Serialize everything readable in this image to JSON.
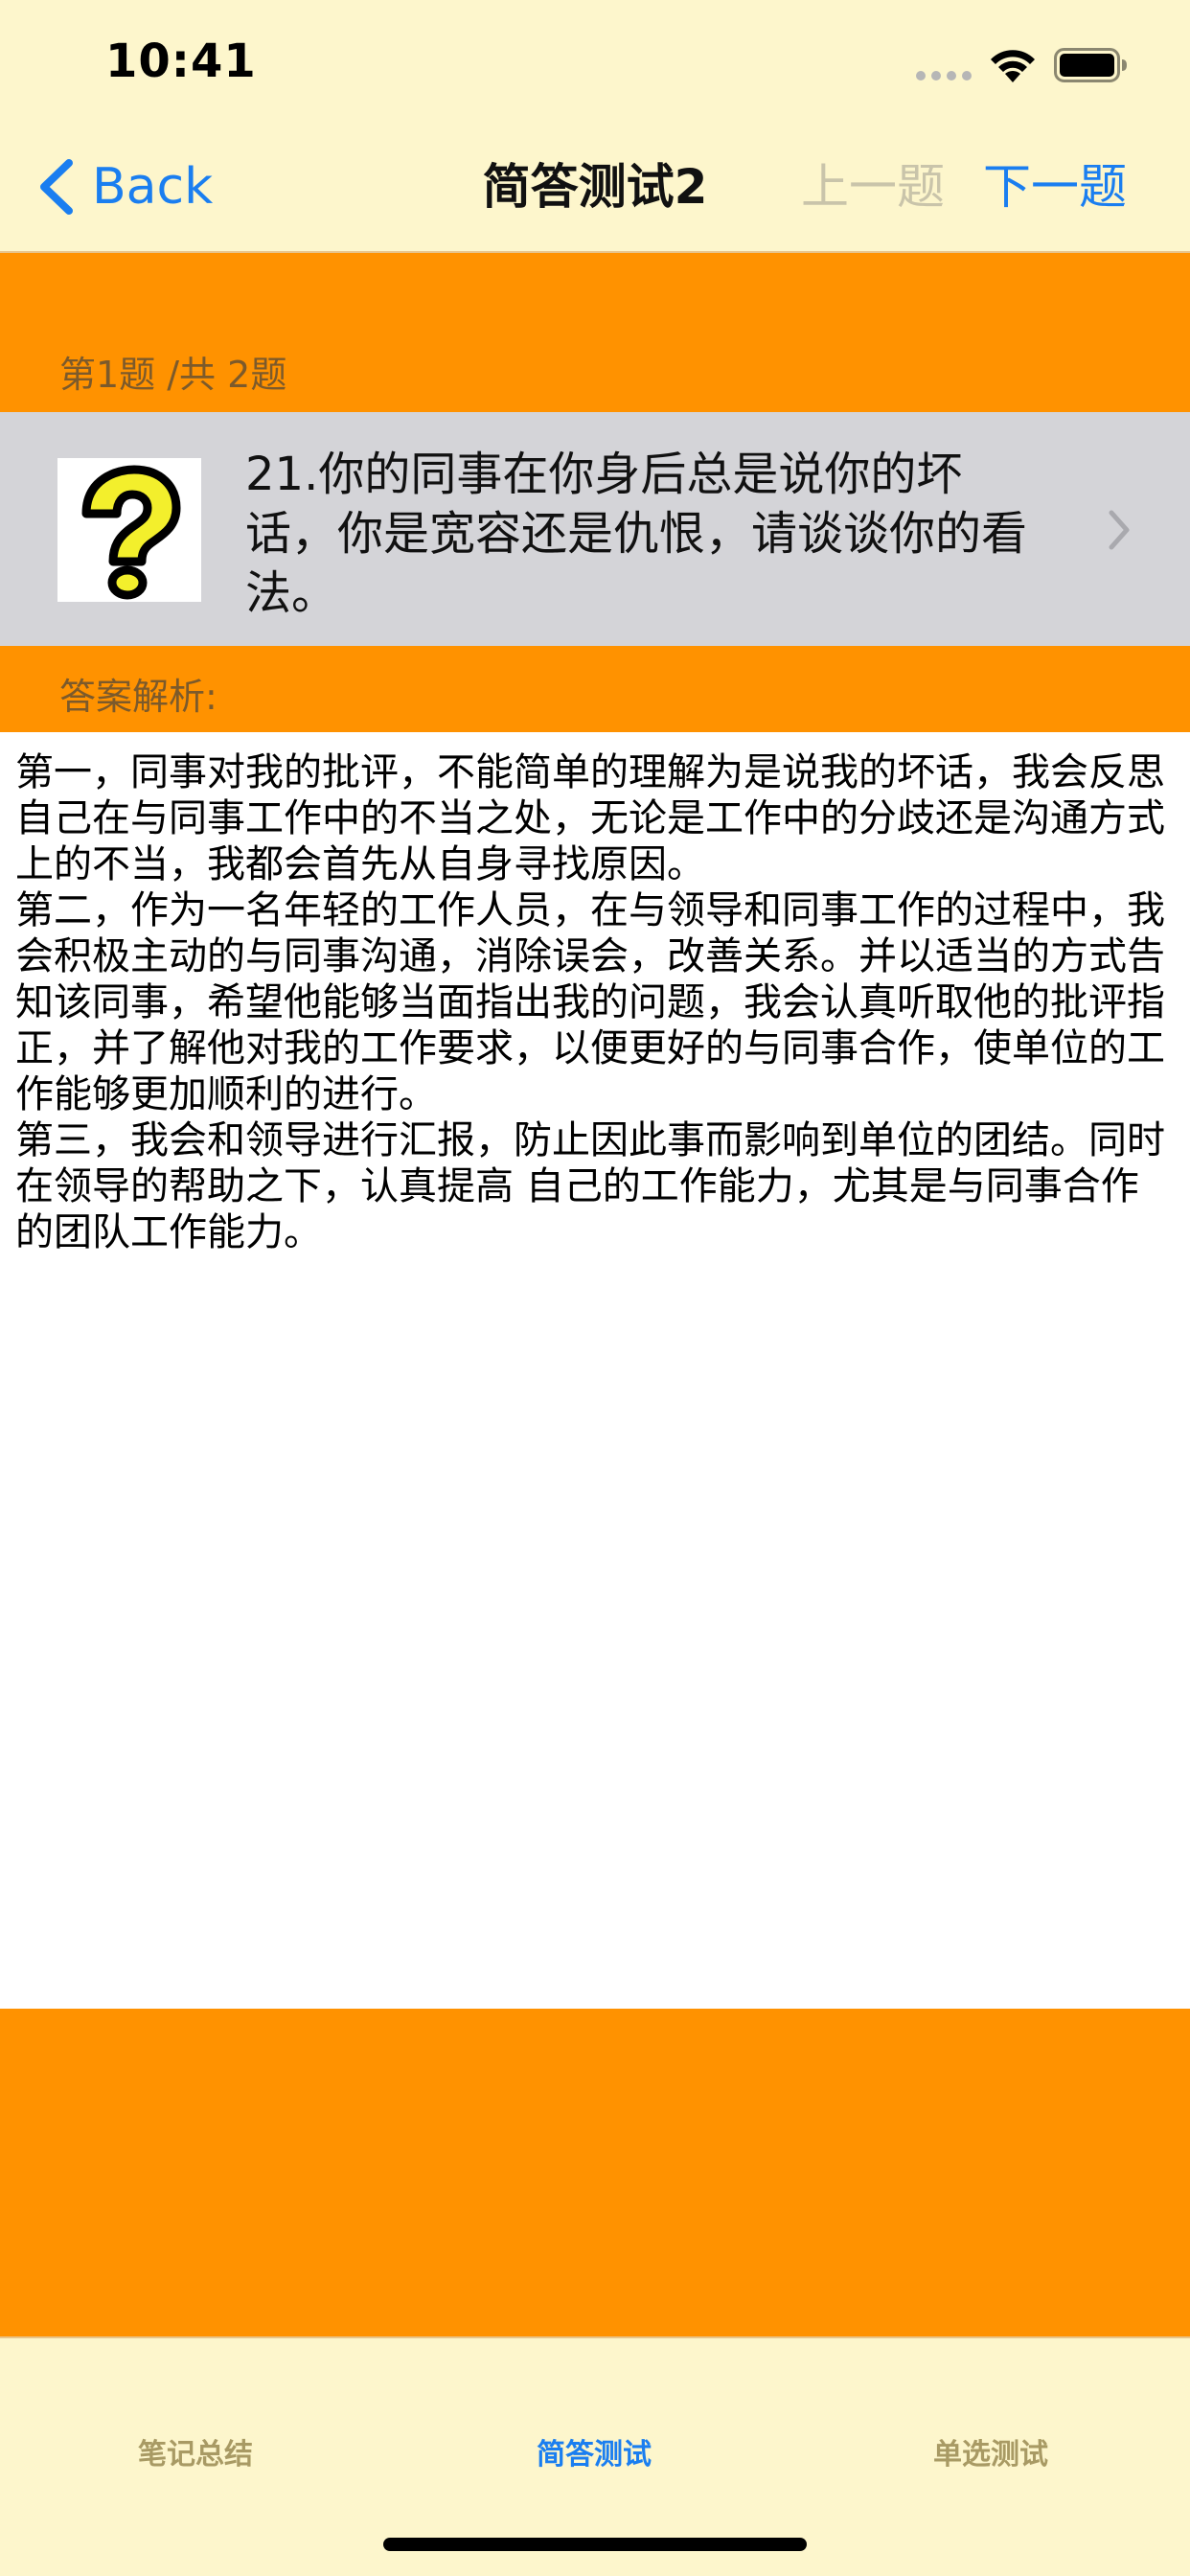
{
  "status_bar": {
    "time": "10:41",
    "icons": [
      "signal-dots-icon",
      "wifi-icon",
      "battery-icon"
    ]
  },
  "nav": {
    "back_label": "Back",
    "title": "简答测试2",
    "prev_label": "上一题",
    "next_label": "下一题"
  },
  "question": {
    "counter": "第1题 /共 2题",
    "text": "21.你的同事在你身后总是说你的坏话，你是宽容还是仇恨，请谈谈你的看法。",
    "icon": "question-mark-icon"
  },
  "answer": {
    "header": "答案解析:",
    "text": "第一，同事对我的批评，不能简单的理解为是说我的坏话，我会反思自己在与同事工作中的不当之处，无论是工作中的分歧还是沟通方式上的不当，我都会首先从自身寻找原因。\n第二，作为一名年轻的工作人员，在与领导和同事工作的过程中，我会积极主动的与同事沟通，消除误会，改善关系。并以适当的方式告知该同事，希望他能够当面指出我的问题，我会认真听取他的批评指正，并了解他对我的工作要求，以便更好的与同事合作，使单位的工作能够更加顺利的进行。\n第三，我会和领导进行汇报，防止因此事而影响到单位的团结。同时在领导的帮助之下，认真提高 自己的工作能力，尤其是与同事合作的团队工作能力。"
  },
  "tabs": [
    {
      "label": "笔记总结",
      "active": false
    },
    {
      "label": "简答测试",
      "active": true
    },
    {
      "label": "单选测试",
      "active": false
    }
  ],
  "colors": {
    "accent": "#1a7ef0",
    "header_bg": "#fdf6cc",
    "section_bg": "#ff9200",
    "row_bg": "#d4d4d8",
    "disabled": "#c9c4aa"
  }
}
